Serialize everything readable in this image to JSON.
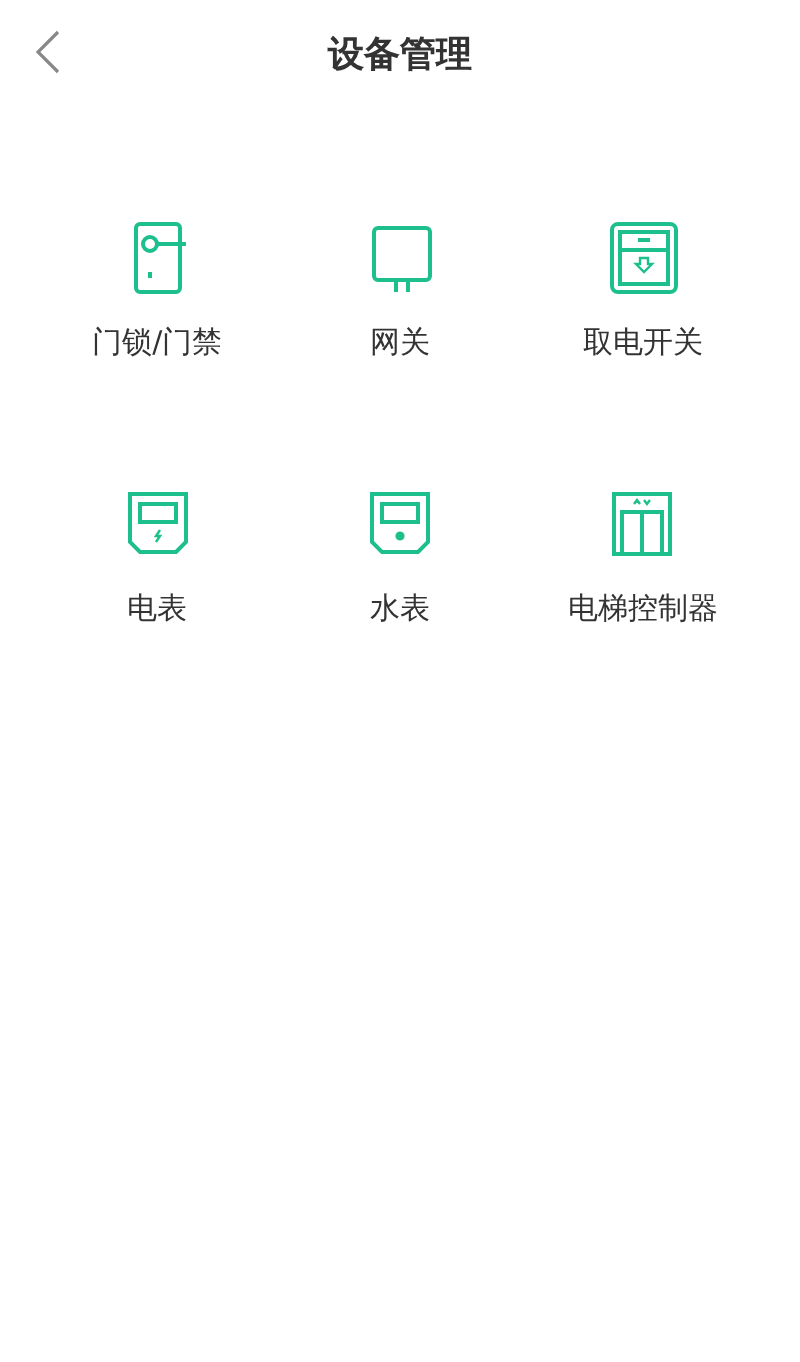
{
  "header": {
    "title": "设备管理"
  },
  "devices": [
    {
      "kind": "lock",
      "label": "门锁/门禁"
    },
    {
      "kind": "gateway",
      "label": "网关"
    },
    {
      "kind": "power_switch",
      "label": "取电开关"
    },
    {
      "kind": "electric_meter",
      "label": "电表"
    },
    {
      "kind": "water_meter",
      "label": "水表"
    },
    {
      "kind": "elevator",
      "label": "电梯控制器"
    }
  ]
}
